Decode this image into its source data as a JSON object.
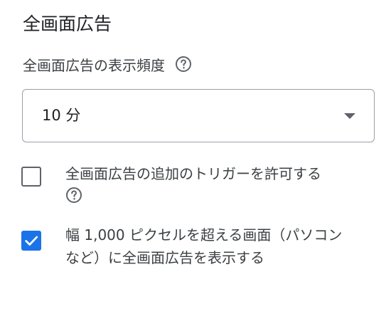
{
  "section": {
    "title": "全画面広告"
  },
  "frequency": {
    "label": "全画面広告の表示頻度",
    "help_icon": "help-circle-icon",
    "selected_value": "10 分"
  },
  "options": {
    "trigger": {
      "label": "全画面広告の追加のトリガーを許可する",
      "checked": false,
      "help_icon": "help-circle-icon"
    },
    "wide_screen": {
      "label_line1": "幅 1,000 ピクセルを超える画面（パソコン",
      "label_line2": "など）に全画面広告を表示する",
      "checked": true
    }
  },
  "colors": {
    "accent": "#1a73e8",
    "text_primary": "#202124",
    "text_secondary": "#3c4043",
    "icon": "#5f6368",
    "border": "#9aa0a6"
  }
}
